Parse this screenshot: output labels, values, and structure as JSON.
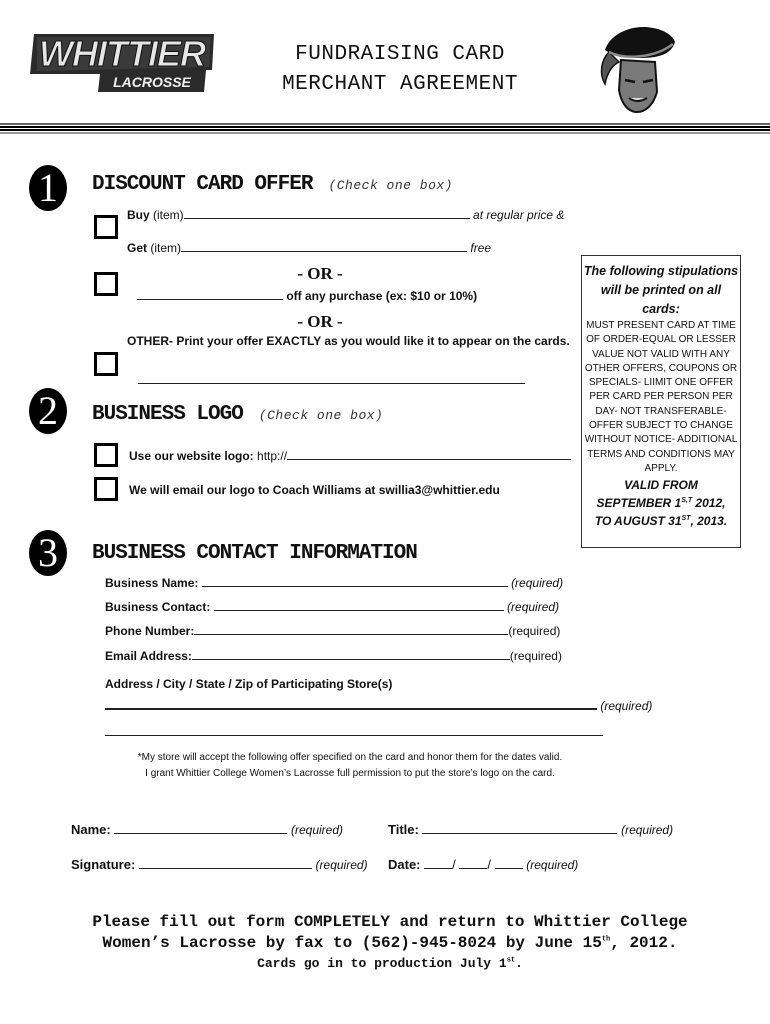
{
  "header": {
    "logo_text_main": "WHITTIER",
    "logo_text_sub": "LACROSSE",
    "title_line1": "FUNDRAISING CARD",
    "title_line2": "MERCHANT AGREEMENT",
    "mascot_icon": "poet-mascot-head"
  },
  "section1": {
    "number": "1",
    "title": "DISCOUNT CARD OFFER",
    "hint": "(Check one box)",
    "option1": {
      "buy_label": "Buy",
      "buy_item": "(item)",
      "buy_suffix": "at regular price &",
      "get_label": "Get",
      "get_item": "(item)",
      "get_suffix": "free",
      "buy_value": "",
      "get_value": ""
    },
    "or_label": "- OR -",
    "option2": {
      "suffix": "off any purchase (ex: $10 or 10%)",
      "value": ""
    },
    "option3": {
      "label": "OTHER- Print your offer EXACTLY as you would like it to appear on the cards.",
      "value": ""
    }
  },
  "stipulations": {
    "head": "The following stipulations will be printed on all cards:",
    "body": "MUST PRESENT CARD AT TIME OF ORDER-EQUAL OR LESSER VALUE NOT VALID WITH ANY OTHER OFFERS, COUPONS OR SPECIALS- LIIMIT ONE OFFER PER CARD PER PERSON PER DAY- NOT TRANSFERABLE- OFFER SUBJECT TO CHANGE WITHOUT NOTICE- ADDITIONAL TERMS AND CONDITIONS MAY APPLY.",
    "valid_line1": "VALID FROM",
    "valid_line2_pre": "SEPTEMBER 1",
    "valid_line2_sup": "S,T",
    "valid_line2_post": " 2012,",
    "valid_line3_pre": "TO AUGUST 31",
    "valid_line3_sup": "ST",
    "valid_line3_post": ", 2013."
  },
  "section2": {
    "number": "2",
    "title": "BUSINESS LOGO",
    "hint": "(Check one box)",
    "option1_label": "Use our website logo:",
    "option1_prefix": "http://",
    "option1_value": "",
    "option2_label": "We will email our logo to Coach Williams at swillia3@whittier.edu"
  },
  "section3": {
    "number": "3",
    "title": "BUSINESS CONTACT INFORMATION",
    "required": "(required)",
    "fields": [
      {
        "label": "Business Name:",
        "value": ""
      },
      {
        "label": "Business Contact:",
        "value": ""
      },
      {
        "label": "Phone Number:",
        "value": ""
      },
      {
        "label": "Email Address:",
        "value": ""
      }
    ],
    "address_label": "Address / City / State / Zip of Participating Store(s)",
    "address_line1": "",
    "address_line2": ""
  },
  "agreement": {
    "line1": "*My store will accept the following offer specified on the card and honor them for the dates valid.",
    "line2": "I grant Whittier College Women’s Lacrosse full permission to put the store’s logo on the card."
  },
  "signoff": {
    "name_label": "Name:",
    "title_label": "Title:",
    "signature_label": "Signature:",
    "date_label": "Date:",
    "date_sep": "/",
    "required": "(required)",
    "name_value": "",
    "title_value": "",
    "signature_value": ""
  },
  "footer": {
    "line1": "Please fill out form COMPLETELY and return to Whittier College",
    "line2_pre": "Women’s Lacrosse by fax to (562)-945-8024 by June 15",
    "line2_sup": "th",
    "line2_post": ", 2012.",
    "line3_pre": "Cards go in to production July 1",
    "line3_sup": "st",
    "line3_post": "."
  }
}
